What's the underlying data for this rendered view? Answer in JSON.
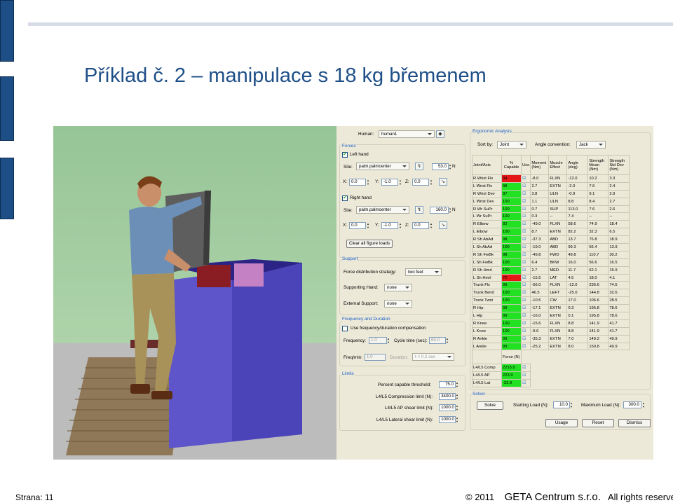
{
  "slide": {
    "title": "Příklad č. 2 – manipulace s 18 kg břemenem",
    "page": "Strana: 11",
    "copyright": "© 2011",
    "company": "GETA Centrum s.r.o.",
    "rights": "All rights reserved"
  },
  "colors": {
    "title": "#1f4f88",
    "accent_bar": "#1d4f86",
    "capable_ok": "#22e022",
    "capable_bad": "#e51717"
  },
  "panel": {
    "human_label": "Human:",
    "human_value": "human1",
    "forces": {
      "header": "Forces",
      "left": {
        "label": "Left hand",
        "site_label": "Site:",
        "site": "palm.palmcenter",
        "magnitude": "53.0",
        "unit": "N",
        "x": "0.0",
        "y": "-1.0",
        "z": "0.0"
      },
      "right": {
        "label": "Right hand",
        "site_label": "Site:",
        "site": "palm.palmcenter",
        "magnitude": "160.0",
        "unit": "N",
        "x": "0.0",
        "y": "-1.0",
        "z": "0.0"
      },
      "x_label": "X:",
      "y_label": "Y:",
      "z_label": "Z:",
      "clear_button": "Clear all figure loads"
    },
    "support": {
      "header": "Support",
      "fds_label": "Force distribution strategy:",
      "fds_value": "two feet",
      "hand_label": "Supporting Hand:",
      "hand_value": "none",
      "ext_label": "External Support:",
      "ext_value": "none"
    },
    "freq": {
      "header": "Frequency and Duration",
      "use_label": "Use frequency/duration compensation",
      "freq_label": "Frequency:",
      "freq_value": "1.0",
      "cycle_label": "Cycle time (sec):",
      "cycle_value": "60.0",
      "fpm_label": "Freq/min:",
      "fpm_value": "1.0",
      "dur_label": "Duration:",
      "dur_value": "t < 0.2 sec"
    },
    "limits": {
      "header": "Limits",
      "pct_label": "Percent capable threshold:",
      "pct_value": "75.0",
      "comp_label": "L4/L5 Compression limit (N):",
      "comp_value": "3400.0",
      "ap_label": "L4/L5 AP shear limit (N):",
      "ap_value": "1000.0",
      "lat_label": "L4/L5 Lateral shear limit (N):",
      "lat_value": "1000.0"
    },
    "ergo": {
      "header": "Ergonomic Analysis",
      "sort_label": "Sort by:",
      "sort_value": "Joint",
      "angle_label": "Angle convention:",
      "angle_value": "Jack",
      "columns": [
        "Joint/Axis",
        "% Capable",
        "Use",
        "Moment (Nm)",
        "Muscle Effect",
        "Angle (deg)",
        "Strength Mean (Nm)",
        "Strength Std Dev (Nm)"
      ],
      "rows": [
        [
          "R Wrist Flx",
          "34",
          "r",
          "-8.0",
          "FLXN",
          "-12.0",
          "10.2",
          "3.3"
        ],
        [
          "L Wrist Flx",
          "98",
          "g",
          "2.7",
          "EXTN",
          "-2.0",
          "7.6",
          "2.4"
        ],
        [
          "R Wrist Dev",
          "97",
          "g",
          "3.8",
          "ULN",
          "-0.9",
          "9.1",
          "2.9"
        ],
        [
          "L Wrist Dev",
          "100",
          "g",
          "1.1",
          "ULN",
          "8.8",
          "8.4",
          "2.7"
        ],
        [
          "R Wr SuPr",
          "100",
          "g",
          "0.7",
          "SUP",
          "113.0",
          "7.6",
          "2.6"
        ],
        [
          "L Wr SuPr",
          "100",
          "g",
          "0.3",
          "--",
          "7.4",
          "--",
          "--"
        ],
        [
          "R Elbow",
          "92",
          "g",
          "-49.0",
          "FLXN",
          "58.6",
          "74.9",
          "18.4"
        ],
        [
          "L Elbow",
          "100",
          "g",
          "8.7",
          "EXTN",
          "82.2",
          "32.3",
          "6.5"
        ],
        [
          "R Sh AbAd",
          "98",
          "g",
          "-37.3",
          "ABD",
          "13.7",
          "76.8",
          "18.9"
        ],
        [
          "L Sh AbAd",
          "100",
          "g",
          "-19.0",
          "ABD",
          "99.3",
          "56.4",
          "13.9"
        ],
        [
          "R Sh FwBk",
          "98",
          "g",
          "-49.8",
          "FWD",
          "49.8",
          "110.7",
          "30.2"
        ],
        [
          "L Sh FwBk",
          "100",
          "g",
          "6.4",
          "BKW",
          "16.0",
          "56.6",
          "16.5"
        ],
        [
          "R Sh Hmrl",
          "100",
          "g",
          "2.7",
          "MED",
          "11.7",
          "62.1",
          "15.9"
        ],
        [
          "L Sh Hmrl",
          "72",
          "r",
          "-15.5",
          "LAT",
          "4.5",
          "18.0",
          "4.1"
        ],
        [
          "Trunk Flx",
          "99",
          "g",
          "-56.0",
          "FLXN",
          "-12.0",
          "236.6",
          "74.5"
        ],
        [
          "Trunk Bend",
          "100",
          "g",
          "46.5",
          "LEFT",
          "-25.0",
          "144.8",
          "32.6"
        ],
        [
          "Trunk Twst",
          "100",
          "g",
          "-10.5",
          "CW",
          "17.0",
          "106.6",
          "28.5"
        ],
        [
          "R Hip",
          "99",
          "g",
          "-17.1",
          "EXTN",
          "0.3",
          "195.8",
          "78.6"
        ],
        [
          "L Hip",
          "99",
          "g",
          "-16.0",
          "EXTN",
          "0.1",
          "195.8",
          "78.6"
        ],
        [
          "R Knee",
          "100",
          "g",
          "-15.6",
          "FLXN",
          "8.8",
          "141.9",
          "41.7"
        ],
        [
          "L Knee",
          "100",
          "g",
          "-9.6",
          "FLXN",
          "8.8",
          "141.9",
          "41.7"
        ],
        [
          "R Ankle",
          "99",
          "g",
          "-35.3",
          "EXTN",
          "7.0",
          "149.2",
          "49.9"
        ],
        [
          "L Ankle",
          "99",
          "g",
          "-25.2",
          "EXTN",
          "8.0",
          "150.8",
          "49.9"
        ]
      ],
      "force_header": "Force (N)",
      "force_rows": [
        [
          "L4/L5 Comp",
          "2215.0"
        ],
        [
          "L4/L5 AP",
          "223.9"
        ],
        [
          "L4/L5 Lat",
          "-23.9"
        ]
      ]
    },
    "solver": {
      "header": "Solver",
      "solve": "Solve",
      "start_label": "Starting Load (N):",
      "start_value": "10.0",
      "max_label": "Maximum Load (N):",
      "max_value": "300.0"
    },
    "buttons": {
      "usage": "Usage",
      "reset": "Reset",
      "dismiss": "Dismiss"
    }
  }
}
